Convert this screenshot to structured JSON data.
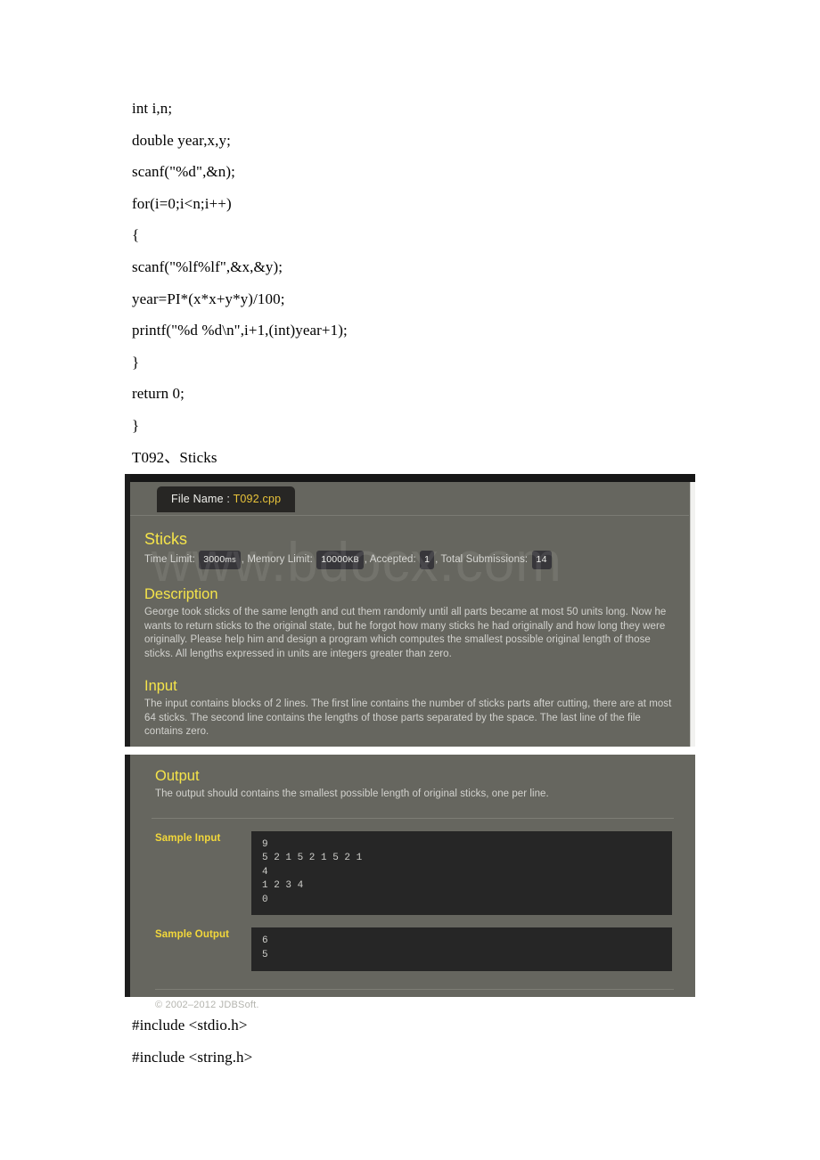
{
  "document": {
    "code_top": [
      "int i,n;",
      "double year,x,y;",
      "scanf(\"%d\",&n);",
      "for(i=0;i<n;i++)",
      "{",
      "scanf(\"%lf%lf\",&x,&y);",
      "year=PI*(x*x+y*y)/100;",
      "printf(\"%d %d\\n\",i+1,(int)year+1);",
      "}",
      "return 0;",
      "}",
      "T092、Sticks"
    ],
    "code_bottom": [
      "#include <stdio.h>",
      "#include <string.h>"
    ]
  },
  "watermark": "www.bdocx.com",
  "oj": {
    "file_tab": {
      "label": "File Name :",
      "value": "T092.cpp"
    },
    "problem_title": "Sticks",
    "stats": {
      "time_limit_label": "Time Limit:",
      "time_limit_value": "3000",
      "time_limit_unit": "ms",
      "memory_limit_label": "Memory Limit:",
      "memory_limit_value": "10000",
      "memory_limit_unit": "KB",
      "accepted_label": "Accepted:",
      "accepted_value": "1",
      "submissions_label": "Total Submissions:",
      "submissions_value": "14",
      "sep": ","
    },
    "description": {
      "heading": "Description",
      "body": "George took sticks of the same length and cut them randomly until all parts became at most 50 units long. Now he wants to return sticks to the original state, but he forgot how many sticks he had originally and how long they were originally. Please help him and design a program which computes the smallest possible original length of those sticks. All lengths expressed in units are integers greater than zero."
    },
    "input": {
      "heading": "Input",
      "body": "The input contains blocks of 2 lines. The first line contains the number of sticks parts after cutting, there are at most 64 sticks. The second line contains the lengths of those parts separated by the space. The last line of the file contains zero."
    },
    "output": {
      "heading": "Output",
      "body": "The output should contains the smallest possible length of original sticks, one per line."
    },
    "sample_input": {
      "label": "Sample Input",
      "text": "9\n5 2 1 5 2 1 5 2 1\n4\n1 2 3 4\n0"
    },
    "sample_output": {
      "label": "Sample Output",
      "text": "6\n5"
    },
    "footer": "© 2002–2012  JDBSoft.",
    "colors": {
      "panel_bg": "#66665f",
      "accent_yellow": "#f5e44a",
      "sample_label": "#f3d83a",
      "code_box_bg": "#262626",
      "tab_bg": "#272624"
    }
  }
}
